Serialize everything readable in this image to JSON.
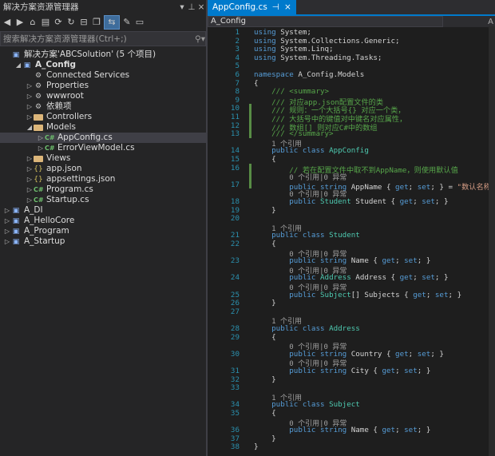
{
  "explorer": {
    "title": "解决方案资源管理器",
    "search_placeholder": "搜索解决方案资源管理器(Ctrl+;)",
    "toolbar_title_btns": [
      "▾",
      "📌",
      "✕"
    ],
    "rows": [
      {
        "indent": 0,
        "arrow": "",
        "icon": "proj",
        "label": "解决方案'ABCSolution' (5 个项目)",
        "bold": false
      },
      {
        "indent": 1,
        "arrow": "◢",
        "icon": "proj",
        "label": "A_Config",
        "bold": true
      },
      {
        "indent": 2,
        "arrow": "",
        "icon": "gear",
        "label": "Connected Services"
      },
      {
        "indent": 2,
        "arrow": "▷",
        "icon": "gear",
        "label": "Properties"
      },
      {
        "indent": 2,
        "arrow": "▷",
        "icon": "gear",
        "label": "wwwroot"
      },
      {
        "indent": 2,
        "arrow": "▷",
        "icon": "gear",
        "label": "依赖项"
      },
      {
        "indent": 2,
        "arrow": "▷",
        "icon": "folder",
        "label": "Controllers"
      },
      {
        "indent": 2,
        "arrow": "◢",
        "icon": "folder",
        "label": "Models"
      },
      {
        "indent": 3,
        "arrow": "▷",
        "icon": "cs",
        "label": "AppConfig.cs",
        "selected": true
      },
      {
        "indent": 3,
        "arrow": "▷",
        "icon": "cs",
        "label": "ErrorViewModel.cs"
      },
      {
        "indent": 2,
        "arrow": "▷",
        "icon": "folder",
        "label": "Views"
      },
      {
        "indent": 2,
        "arrow": "▷",
        "icon": "json",
        "label": "app.json"
      },
      {
        "indent": 2,
        "arrow": "▷",
        "icon": "json",
        "label": "appsettings.json"
      },
      {
        "indent": 2,
        "arrow": "▷",
        "icon": "cs",
        "label": "Program.cs"
      },
      {
        "indent": 2,
        "arrow": "▷",
        "icon": "cs",
        "label": "Startup.cs"
      },
      {
        "indent": 0,
        "arrow": "▷",
        "icon": "proj",
        "label": "A_DI"
      },
      {
        "indent": 0,
        "arrow": "▷",
        "icon": "proj",
        "label": "A_HelloCore"
      },
      {
        "indent": 0,
        "arrow": "▷",
        "icon": "proj",
        "label": "A_Program"
      },
      {
        "indent": 0,
        "arrow": "▷",
        "icon": "proj",
        "label": "A_Startup"
      }
    ]
  },
  "editor": {
    "tab": "AppConfig.cs",
    "nav_left": "A_Config",
    "nav_right": "A",
    "lines": [
      {
        "n": "1",
        "h": "<span class=\"kw\">using</span> System;"
      },
      {
        "n": "2",
        "h": "<span class=\"kw\">using</span> System.Collections.Generic;"
      },
      {
        "n": "3",
        "h": "<span class=\"kw\">using</span> System.Linq;"
      },
      {
        "n": "4",
        "h": "<span class=\"kw\">using</span> System.Threading.Tasks;"
      },
      {
        "n": "5",
        "h": ""
      },
      {
        "n": "6",
        "h": "<span class=\"kw\">namespace</span> A_Config.Models"
      },
      {
        "n": "7",
        "h": "{"
      },
      {
        "n": "8",
        "h": "    <span class=\"cm\">/// &lt;summary&gt;</span>"
      },
      {
        "n": "9",
        "h": "    <span class=\"cm\">/// 对应app.json配置文件的类</span>"
      },
      {
        "n": "10",
        "h": "    <span class=\"cm\">/// 规则：一个大括号{} 对应一个类，</span>"
      },
      {
        "n": "11",
        "h": "    <span class=\"cm\">/// 大括号中的键值对中键名对应属性，</span>"
      },
      {
        "n": "12",
        "h": "    <span class=\"cm\">/// 数组[] 则对应C#中的数组</span>"
      },
      {
        "n": "13",
        "h": "    <span class=\"cm\">/// &lt;/summary&gt;</span>"
      },
      {
        "n": "",
        "h": "    <span class=\"ref\">1 个引用</span>"
      },
      {
        "n": "14",
        "h": "    <span class=\"kw\">public class</span> <span class=\"ty\">AppConfig</span>"
      },
      {
        "n": "15",
        "h": "    {"
      },
      {
        "n": "16",
        "h": "        <span class=\"cm\">// 若在配置文件中取不到AppName，则使用默认值</span>"
      },
      {
        "n": "",
        "h": "        <span class=\"ref\">0 个引用|0 异常</span>"
      },
      {
        "n": "17",
        "h": "        <span class=\"kw\">public string</span> AppName { <span class=\"kw\">get</span>; <span class=\"kw\">set</span>; } = <span class=\"st\">\"数认名称\"</span>;"
      },
      {
        "n": "",
        "h": "        <span class=\"ref\">0 个引用|0 异常</span>"
      },
      {
        "n": "18",
        "h": "        <span class=\"kw\">public</span> <span class=\"ty\">Student</span> Student { <span class=\"kw\">get</span>; <span class=\"kw\">set</span>; }"
      },
      {
        "n": "19",
        "h": "    }"
      },
      {
        "n": "20",
        "h": ""
      },
      {
        "n": "",
        "h": "    <span class=\"ref\">1 个引用</span>"
      },
      {
        "n": "21",
        "h": "    <span class=\"kw\">public class</span> <span class=\"ty\">Student</span>"
      },
      {
        "n": "22",
        "h": "    {"
      },
      {
        "n": "",
        "h": "        <span class=\"ref\">0 个引用|0 异常</span>"
      },
      {
        "n": "23",
        "h": "        <span class=\"kw\">public string</span> Name { <span class=\"kw\">get</span>; <span class=\"kw\">set</span>; }"
      },
      {
        "n": "",
        "h": "        <span class=\"ref\">0 个引用|0 异常</span>"
      },
      {
        "n": "24",
        "h": "        <span class=\"kw\">public</span> <span class=\"ty\">Address</span> Address { <span class=\"kw\">get</span>; <span class=\"kw\">set</span>; }"
      },
      {
        "n": "",
        "h": "        <span class=\"ref\">0 个引用|0 异常</span>"
      },
      {
        "n": "25",
        "h": "        <span class=\"kw\">public</span> <span class=\"ty\">Subject</span>[] Subjects { <span class=\"kw\">get</span>; <span class=\"kw\">set</span>; }"
      },
      {
        "n": "26",
        "h": "    }"
      },
      {
        "n": "27",
        "h": ""
      },
      {
        "n": "",
        "h": "    <span class=\"ref\">1 个引用</span>"
      },
      {
        "n": "28",
        "h": "    <span class=\"kw\">public class</span> <span class=\"ty\">Address</span>"
      },
      {
        "n": "29",
        "h": "    {"
      },
      {
        "n": "",
        "h": "        <span class=\"ref\">0 个引用|0 异常</span>"
      },
      {
        "n": "30",
        "h": "        <span class=\"kw\">public string</span> Country { <span class=\"kw\">get</span>; <span class=\"kw\">set</span>; }"
      },
      {
        "n": "",
        "h": "        <span class=\"ref\">0 个引用|0 异常</span>"
      },
      {
        "n": "31",
        "h": "        <span class=\"kw\">public string</span> City { <span class=\"kw\">get</span>; <span class=\"kw\">set</span>; }"
      },
      {
        "n": "32",
        "h": "    }"
      },
      {
        "n": "33",
        "h": ""
      },
      {
        "n": "",
        "h": "    <span class=\"ref\">1 个引用</span>"
      },
      {
        "n": "34",
        "h": "    <span class=\"kw\">public class</span> <span class=\"ty\">Subject</span>"
      },
      {
        "n": "35",
        "h": "    {"
      },
      {
        "n": "",
        "h": "        <span class=\"ref\">0 个引用|0 异常</span>"
      },
      {
        "n": "36",
        "h": "        <span class=\"kw\">public string</span> Name { <span class=\"kw\">get</span>; <span class=\"kw\">set</span>; }"
      },
      {
        "n": "37",
        "h": "    }"
      },
      {
        "n": "38",
        "h": "}"
      }
    ]
  }
}
